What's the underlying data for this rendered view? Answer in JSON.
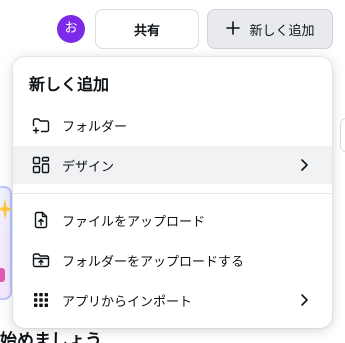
{
  "header": {
    "avatar_initial": "お",
    "share_label": "共有",
    "new_label": "新しく追加"
  },
  "background": {
    "heading_partial": "始めましょう"
  },
  "menu": {
    "title": "新しく追加",
    "items": [
      {
        "label": "フォルダー",
        "icon": "folder-plus-icon",
        "submenu": false
      },
      {
        "label": "デザイン",
        "icon": "design-grid-icon",
        "submenu": true,
        "active": true
      },
      {
        "label": "ファイルをアップロード",
        "icon": "file-upload-icon",
        "submenu": false
      },
      {
        "label": "フォルダーをアップロードする",
        "icon": "folder-upload-icon",
        "submenu": false
      },
      {
        "label": "アプリからインポート",
        "icon": "apps-grid-icon",
        "submenu": true
      }
    ]
  },
  "colors": {
    "avatar": "#7d2ae8",
    "active_item_bg": "#f1f2f4",
    "new_button_bg": "#e8eaed"
  }
}
